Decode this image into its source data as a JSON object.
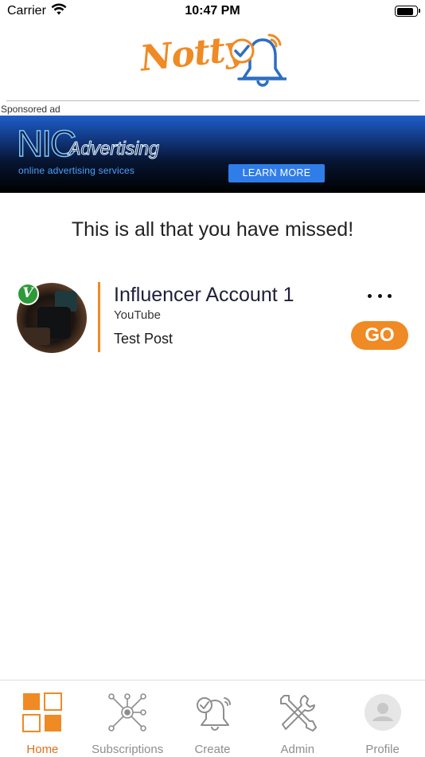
{
  "status_bar": {
    "carrier": "Carrier",
    "time": "10:47 PM",
    "battery_level": 0.9
  },
  "header": {
    "logo_text": "Notty",
    "logo_icon": "bell-check-icon"
  },
  "ad": {
    "label": "Sponsored ad",
    "brand": "NIC",
    "brand_suffix": "Advertising",
    "tagline": "online advertising services",
    "cta": "LEARN MORE"
  },
  "main": {
    "title": "This is all that you have missed!"
  },
  "notifications": [
    {
      "account": "Influencer Account 1",
      "platform": "YouTube",
      "post": "Test Post",
      "badge": "V",
      "badge_color": "#2e9a3a",
      "go_label": "GO",
      "more_icon": "ellipsis-icon"
    }
  ],
  "tabs": [
    {
      "label": "Home",
      "icon": "grid-icon",
      "active": true
    },
    {
      "label": "Subscriptions",
      "icon": "network-icon",
      "active": false
    },
    {
      "label": "Create",
      "icon": "bell-check-icon",
      "active": false
    },
    {
      "label": "Admin",
      "icon": "tools-icon",
      "active": false
    },
    {
      "label": "Profile",
      "icon": "user-icon",
      "active": false
    }
  ],
  "colors": {
    "accent": "#f08a24",
    "active_tab": "#e0701c",
    "inactive_tab": "#8e8e8e",
    "logo_blue": "#2d6fc0"
  }
}
